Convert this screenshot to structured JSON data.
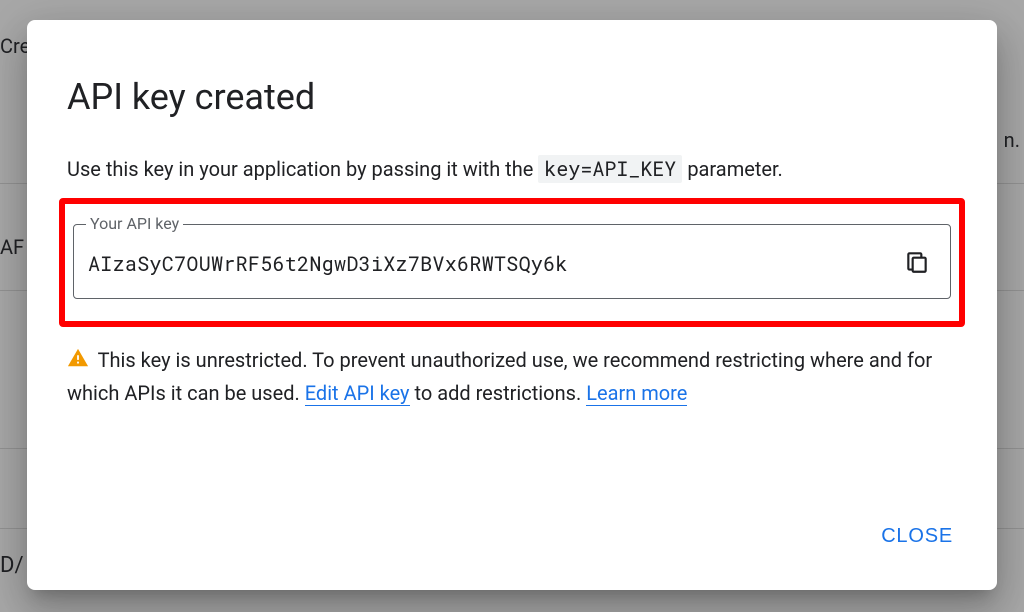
{
  "dialog": {
    "title": "API key created",
    "description_prefix": "Use this key in your application by passing it with the ",
    "description_code": "key=API_KEY",
    "description_suffix": " parameter.",
    "api_field_label": "Your API key",
    "api_key_value": "AIzaSyC7OUWrRF56t2NgwD3iXz7BVx6RWTSQy6k",
    "warning_prefix": "This key is unrestricted. To prevent unauthorized use, we recommend restricting where and for which APIs it can be used. ",
    "edit_link_text": "Edit API key",
    "warning_mid": " to add restrictions. ",
    "learn_more_text": "Learn more",
    "close_label": "CLOSE"
  },
  "bg": {
    "frag1": "Cre",
    "frag2": "n.",
    "frag3": "AF",
    "frag4": "D/"
  },
  "colors": {
    "highlight": "#ff0000",
    "link": "#1a73e8",
    "warning_icon": "#f29900"
  }
}
